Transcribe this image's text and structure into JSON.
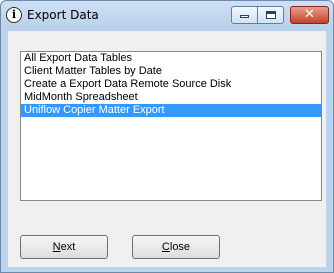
{
  "window": {
    "title": "Export Data",
    "icon": "app-logo-icon",
    "controls": {
      "minimize": "minimize-icon",
      "maximize": "maximize-icon",
      "close": "close-icon",
      "close_glyph": "✕"
    }
  },
  "list": {
    "items": [
      {
        "label": "All Export Data Tables",
        "selected": false
      },
      {
        "label": "Client Matter Tables by Date",
        "selected": false
      },
      {
        "label": "Create a Export Data Remote Source Disk",
        "selected": false
      },
      {
        "label": "MidMonth Spreadsheet",
        "selected": false
      },
      {
        "label": "Uniflow Copier Matter Export",
        "selected": true
      }
    ]
  },
  "buttons": {
    "next": {
      "mnemonic": "N",
      "rest": "ext"
    },
    "close": {
      "mnemonic": "C",
      "rest": "lose"
    }
  },
  "colors": {
    "selection": "#3399ff",
    "frame": "#bcd5ee",
    "close_button": "#c4412a"
  }
}
